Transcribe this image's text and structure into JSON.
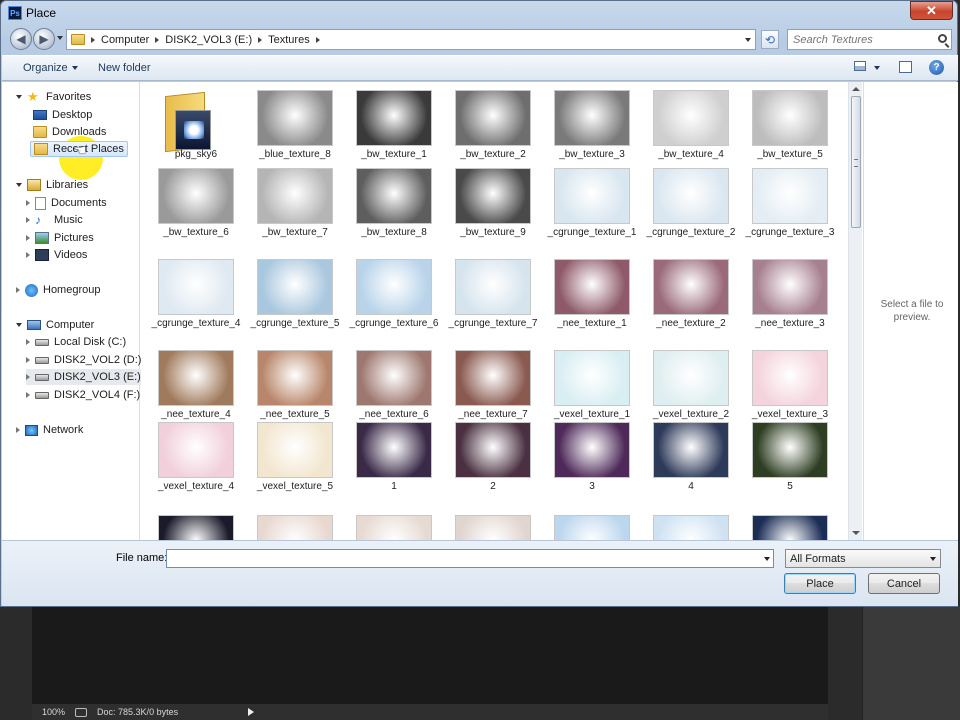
{
  "window": {
    "title": "Place",
    "app_icon": "Ps",
    "close_label": "✕"
  },
  "address": {
    "crumbs": [
      "Computer",
      "DISK2_VOL3 (E:)",
      "Textures"
    ]
  },
  "search": {
    "placeholder": "Search Textures"
  },
  "toolbar": {
    "organize_label": "Organize",
    "new_folder_label": "New folder"
  },
  "nav": {
    "favorites": "Favorites",
    "desktop": "Desktop",
    "downloads": "Downloads",
    "recent_places": "Recent Places",
    "libraries": "Libraries",
    "documents": "Documents",
    "music": "Music",
    "pictures": "Pictures",
    "videos": "Videos",
    "homegroup": "Homegroup",
    "computer": "Computer",
    "local_disk": "Local Disk (C:)",
    "disk_d": "DISK2_VOL2 (D:)",
    "disk_e": "DISK2_VOL3 (E:)",
    "disk_f": "DISK2_VOL4 (F:)",
    "network": "Network"
  },
  "files": [
    {
      "name": "pkg_sky6",
      "color": "#folder"
    },
    {
      "name": "_blue_texture_8",
      "color": "#8a8a8a"
    },
    {
      "name": "_bw_texture_1",
      "color": "#3a3a3a"
    },
    {
      "name": "_bw_texture_2",
      "color": "#6e6e6e"
    },
    {
      "name": "_bw_texture_3",
      "color": "#7a7a7a"
    },
    {
      "name": "_bw_texture_4",
      "color": "#cfcfcf"
    },
    {
      "name": "_bw_texture_5",
      "color": "#bdbdbd"
    },
    {
      "name": "_bw_texture_6",
      "color": "#9a9a9a"
    },
    {
      "name": "_bw_texture_7",
      "color": "#b5b5b5"
    },
    {
      "name": "_bw_texture_8",
      "color": "#5e5e5e"
    },
    {
      "name": "_bw_texture_9",
      "color": "#4a4a4a"
    },
    {
      "name": "_cgrunge_texture_1",
      "color": "#d8e6ef"
    },
    {
      "name": "_cgrunge_texture_2",
      "color": "#dbe7f0"
    },
    {
      "name": "_cgrunge_texture_3",
      "color": "#e3edf3"
    },
    {
      "name": "_cgrunge_texture_4",
      "color": "#dfe9f1"
    },
    {
      "name": "_cgrunge_texture_5",
      "color": "#a9c7de"
    },
    {
      "name": "_cgrunge_texture_6",
      "color": "#b9d4ea"
    },
    {
      "name": "_cgrunge_texture_7",
      "color": "#d6e4ee"
    },
    {
      "name": "_nee_texture_1",
      "color": "#8e5a6a"
    },
    {
      "name": "_nee_texture_2",
      "color": "#9a6a7a"
    },
    {
      "name": "_nee_texture_3",
      "color": "#a78090"
    },
    {
      "name": "_nee_texture_4",
      "color": "#a07a5c"
    },
    {
      "name": "_nee_texture_5",
      "color": "#b8866a"
    },
    {
      "name": "_nee_texture_6",
      "color": "#9e7870"
    },
    {
      "name": "_nee_texture_7",
      "color": "#8a5a50"
    },
    {
      "name": "_vexel_texture_1",
      "color": "#d9eef2"
    },
    {
      "name": "_vexel_texture_2",
      "color": "#dfeef0"
    },
    {
      "name": "_vexel_texture_3",
      "color": "#f4d3dc"
    },
    {
      "name": "_vexel_texture_4",
      "color": "#f1cfdb"
    },
    {
      "name": "_vexel_texture_5",
      "color": "#f2e6cf"
    },
    {
      "name": "1",
      "color": "#3a2a48"
    },
    {
      "name": "2",
      "color": "#4a3040"
    },
    {
      "name": "3",
      "color": "#4e2a5a"
    },
    {
      "name": "4",
      "color": "#2e3a5a"
    },
    {
      "name": "5",
      "color": "#2e3e22"
    },
    {
      "name": "",
      "color": "#1a1a2a"
    },
    {
      "name": "",
      "color": "#e8d8d0"
    },
    {
      "name": "",
      "color": "#e6dad2"
    },
    {
      "name": "",
      "color": "#e1d5cf"
    },
    {
      "name": "",
      "color": "#bcd6ee"
    },
    {
      "name": "",
      "color": "#cfe2f2"
    },
    {
      "name": "",
      "color": "#1c2e56"
    }
  ],
  "preview": {
    "text": "Select a file to preview."
  },
  "bottom": {
    "file_name_label": "File name:",
    "file_name_value": "",
    "format": "All Formats",
    "place_label": "Place",
    "cancel_label": "Cancel"
  },
  "ps_status": {
    "zoom": "100%",
    "doc": "Doc: 785.3K/0 bytes"
  }
}
